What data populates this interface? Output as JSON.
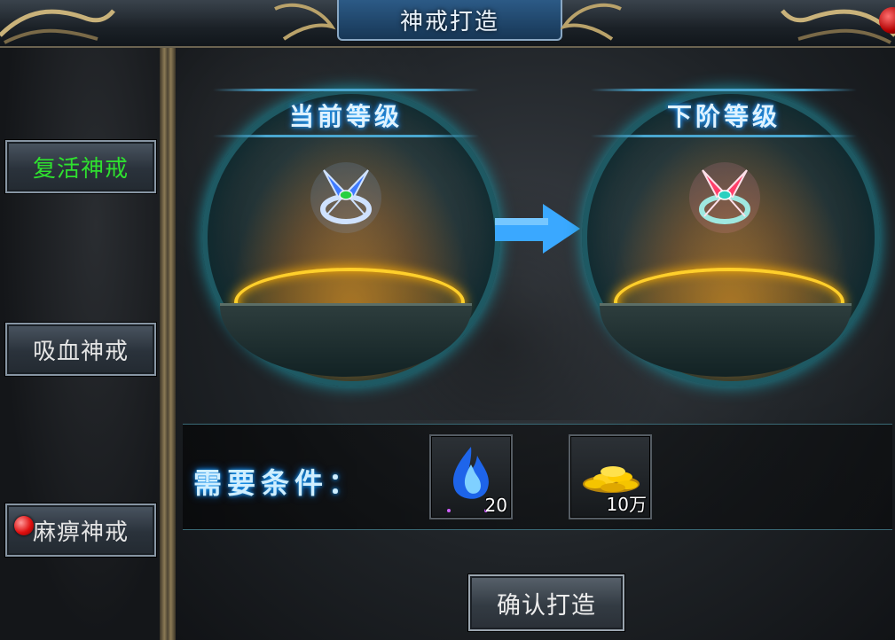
{
  "window": {
    "title": "神戒打造"
  },
  "sidebar": {
    "items": [
      {
        "label": "复活神戒",
        "selected": true,
        "label_color": "#2fe02f"
      },
      {
        "label": "吸血神戒",
        "selected": false
      },
      {
        "label": "麻痹神戒",
        "selected": false,
        "notification": true
      }
    ]
  },
  "upgrade": {
    "current_level_label": "当前等级",
    "next_level_label": "下阶等级",
    "current_ring_color": "#4a8cff",
    "next_ring_color": "#ff3f6a"
  },
  "requirements": {
    "label": "需要条件：",
    "items": [
      {
        "icon": "blue-soul-flame-icon",
        "count": "20"
      },
      {
        "icon": "gold-coins-icon",
        "count": "10万"
      }
    ]
  },
  "actions": {
    "confirm_label": "确认打造"
  },
  "colors": {
    "accent_glow": "#1aa3ff",
    "ring_gold": "#ffcf2b",
    "sphere_border": "#1e5963"
  }
}
